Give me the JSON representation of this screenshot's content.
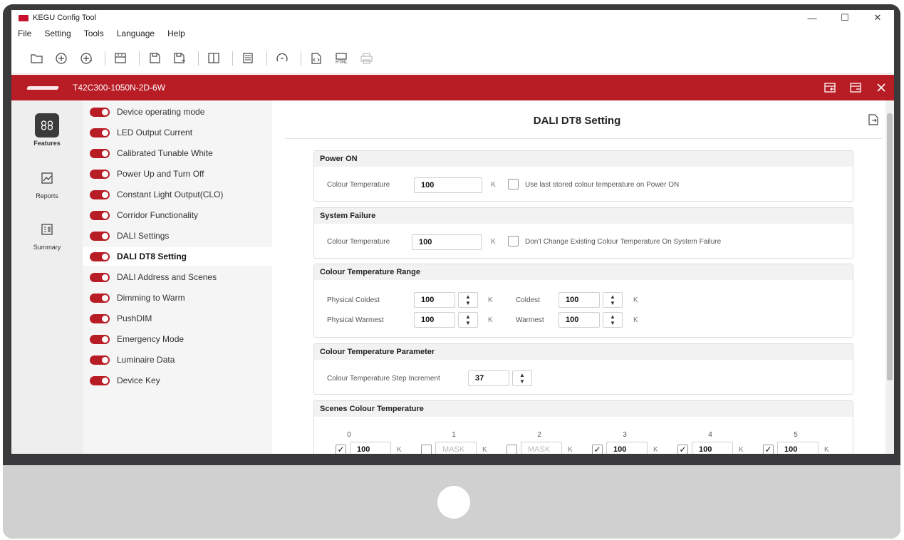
{
  "window": {
    "title": "KEGU Config Tool",
    "minimize": "—",
    "maximize": "☐",
    "close": "✕"
  },
  "menu": [
    "File",
    "Setting",
    "Tools",
    "Language",
    "Help"
  ],
  "device": {
    "model": "T42C300-1050N-2D-6W"
  },
  "leftnav": [
    {
      "label": "Features",
      "icon": "features-icon"
    },
    {
      "label": "Reports",
      "icon": "reports-icon"
    },
    {
      "label": "Summary",
      "icon": "summary-icon"
    }
  ],
  "features": [
    "Device operating mode",
    "LED Output Current",
    "Calibrated Tunable White",
    "Power Up and Turn Off",
    "Constant Light Output(CLO)",
    "Corridor Functionality",
    "DALI Settings",
    "DALI DT8 Setting",
    "DALI Address and Scenes",
    "Dimming to Warm",
    "PushDIM",
    "Emergency Mode",
    "Luminaire Data",
    "Device Key"
  ],
  "main": {
    "title": "DALI DT8 Setting",
    "power_on": {
      "header": "Power ON",
      "label": "Colour Temperature",
      "value": "100",
      "unit": "K",
      "checkbox_label": "Use last stored colour temperature on Power ON"
    },
    "system_failure": {
      "header": "System Failure",
      "label": "Colour Temperature",
      "value": "100",
      "unit": "K",
      "checkbox_label": "Don't Change Existing Colour Temperature On System Failure"
    },
    "range": {
      "header": "Colour Temperature Range",
      "physical_coldest_label": "Physical Coldest",
      "physical_coldest": "100",
      "physical_warmest_label": "Physical Warmest",
      "physical_warmest": "100",
      "coldest_label": "Coldest",
      "coldest": "100",
      "warmest_label": "Warmest",
      "warmest": "100",
      "unit": "K"
    },
    "parameter": {
      "header": "Colour Temperature Parameter",
      "step_label": "Colour Temperature Step Increment",
      "step_value": "37"
    },
    "scenes": {
      "header": "Scenes Colour Temperature",
      "unit": "K",
      "items": [
        {
          "index": "0",
          "checked": true,
          "value": "100"
        },
        {
          "index": "1",
          "checked": false,
          "value": "MASK"
        },
        {
          "index": "2",
          "checked": false,
          "value": "MASK"
        },
        {
          "index": "3",
          "checked": true,
          "value": "100"
        },
        {
          "index": "4",
          "checked": true,
          "value": "100"
        },
        {
          "index": "5",
          "checked": true,
          "value": "100"
        }
      ]
    }
  },
  "colors": {
    "accent": "#b81c25",
    "frame": "#3a3a3c",
    "chin": "#d0d0d0"
  }
}
